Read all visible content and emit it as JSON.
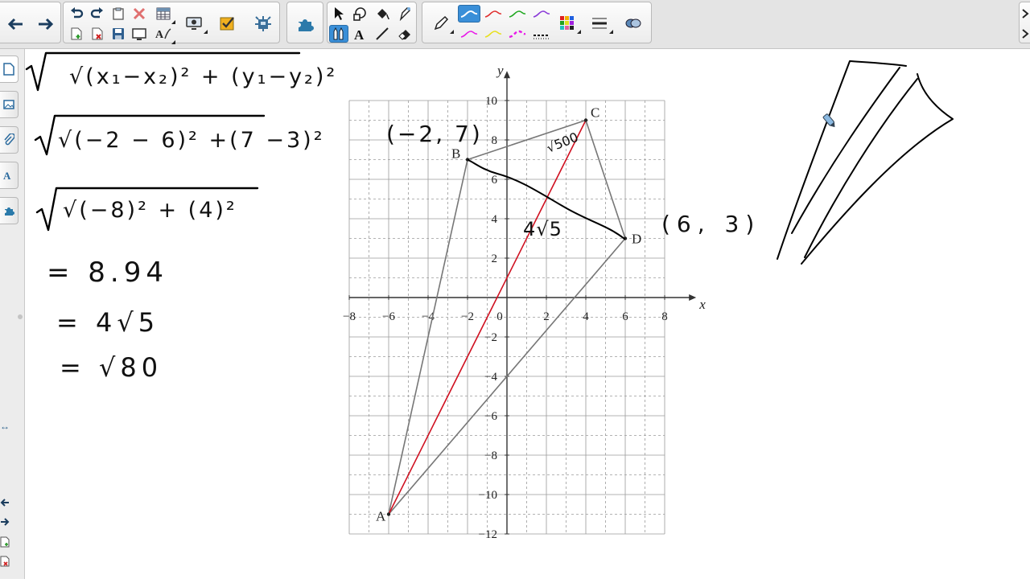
{
  "toolbar": {
    "groups": [
      {
        "name": "navigation",
        "items": [
          "back-arrow-icon",
          "forward-arrow-icon"
        ]
      },
      {
        "name": "edit",
        "items": [
          "undo-icon",
          "redo-icon",
          "paste-icon",
          "delete-icon",
          "table-icon",
          "new-page-icon",
          "delete-page-icon",
          "save-icon",
          "screen-shade-icon",
          "font-icon",
          "document-camera-icon",
          "activity-builder-icon",
          "add-ons-icon"
        ]
      },
      {
        "name": "addons",
        "items": [
          "puzzle-icon"
        ]
      },
      {
        "name": "tools",
        "items": [
          "select-icon",
          "shapes-icon",
          "fill-icon",
          "magic-pen-icon",
          "pens-icon",
          "text-icon",
          "line-icon",
          "eraser-icon"
        ]
      },
      {
        "name": "pen-styles",
        "items": [
          "pen-icon",
          "pen-style-blue",
          "pen-style-red",
          "pen-style-green",
          "pen-style-purple",
          "pen-style-magenta",
          "pen-style-yellow",
          "pen-style-dashed",
          "pen-style-dotted",
          "color-palette-icon",
          "line-width-icon",
          "properties-icon"
        ]
      }
    ],
    "pen_colors": [
      "#3a8fd8",
      "#e03030",
      "#22a822",
      "#8a3ad8",
      "#e81ae8",
      "#e8e020",
      "#e81ae8",
      "#000000"
    ],
    "selected_tool": "pens-icon",
    "selected_pen_style": "pen-style-blue"
  },
  "sidebar": {
    "tabs": [
      "page-sorter-icon",
      "gallery-icon",
      "attachments-icon",
      "properties-icon",
      "add-ons-icon"
    ],
    "active_tab": "page-sorter-icon",
    "bottom_icons": [
      "previous-page-icon",
      "next-page-icon",
      "new-page-icon",
      "delete-page-icon"
    ]
  },
  "work": {
    "line1": "√(x₁−x₂)² + (y₁−y₂)²",
    "line2": "√(−2 − 6)² +(7 −3)²",
    "line3": "√(−8)² + (4)²",
    "line4": "= 8.94",
    "line5": "= 4√5",
    "line6": "= √80"
  },
  "graph": {
    "x_axis_label": "x",
    "y_axis_label": "y",
    "x_ticks": [
      "−8",
      "−6",
      "−4",
      "−2",
      "0",
      "2",
      "4",
      "6",
      "8"
    ],
    "y_ticks": [
      "10",
      "8",
      "6",
      "4",
      "2",
      "−2",
      "−4",
      "−6",
      "−8",
      "−10",
      "−12"
    ],
    "points": [
      {
        "label": "A",
        "x": -6,
        "y": -11
      },
      {
        "label": "B",
        "x": -2,
        "y": 7
      },
      {
        "label": "C",
        "x": 4,
        "y": 9
      },
      {
        "label": "D",
        "x": 6,
        "y": 3
      }
    ],
    "colors": {
      "polygon": "#777777",
      "diagonal_ac": "#d01020",
      "ink": "#000000"
    }
  },
  "annotations": {
    "coord_b": "(−2, 7)",
    "coord_d": "(6, 3)",
    "bd_length": "4√5",
    "ac_length": "√500"
  }
}
